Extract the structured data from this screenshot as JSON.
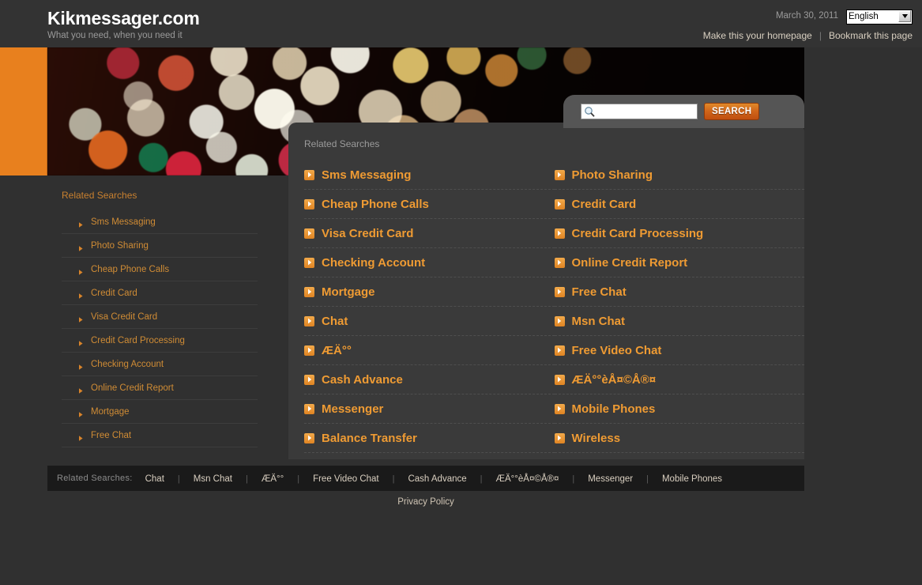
{
  "header": {
    "brand_title": "Kikmessager.com",
    "tagline": "What you need, when you need it",
    "date": "March 30, 2011",
    "language_selected": "English",
    "language_options": [
      "English"
    ],
    "homepage_link": "Make this your homepage",
    "separator": "|",
    "bookmark_link": "Bookmark this page"
  },
  "search": {
    "value": "",
    "placeholder": "",
    "button_label": "SEARCH",
    "icon": "search-icon"
  },
  "results_panel": {
    "heading": "Related Searches",
    "items": [
      "Sms Messaging",
      "Photo Sharing",
      "Cheap Phone Calls",
      "Credit Card",
      "Visa Credit Card",
      "Credit Card Processing",
      "Checking Account",
      "Online Credit Report",
      "Mortgage",
      "Free Chat",
      "Chat",
      "Msn Chat",
      "ÆÄ°°",
      "Free Video Chat",
      "Cash Advance",
      "ÆÄ°°èÅ¤©Å®¤",
      "Messenger",
      "Mobile Phones",
      "Balance Transfer",
      "Wireless"
    ]
  },
  "sidebar": {
    "heading": "Related Searches",
    "items": [
      "Sms Messaging",
      "Photo Sharing",
      "Cheap Phone Calls",
      "Credit Card",
      "Visa Credit Card",
      "Credit Card Processing",
      "Checking Account",
      "Online Credit Report",
      "Mortgage",
      "Free Chat"
    ]
  },
  "footer": {
    "label": "Related Searches:",
    "separator": "|",
    "links": [
      "Chat",
      "Msn Chat",
      "ÆÄ°°",
      "Free Video Chat",
      "Cash Advance",
      "ÆÄ°°èÅ¤©Å®¤",
      "Messenger",
      "Mobile Phones"
    ],
    "privacy_policy": "Privacy Policy"
  },
  "colors": {
    "accent_orange": "#e8801e",
    "link_orange": "#ef9b33",
    "sidebar_orange": "#d08c35",
    "page_bg": "#303030",
    "panel_bg": "#3a3a3a",
    "footer_bg": "#1a1a1a"
  }
}
